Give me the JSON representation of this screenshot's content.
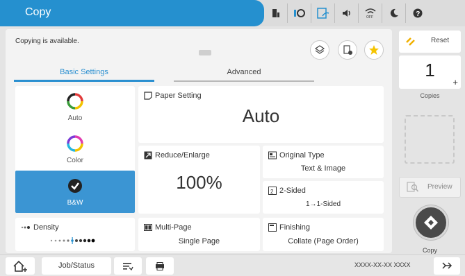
{
  "header": {
    "title": "Copy",
    "icons": [
      "ink-levels-icon",
      "device-info-icon",
      "wifi-direct-icon",
      "sound-icon",
      "wifi-off-icon",
      "sleep-icon",
      "help-icon"
    ]
  },
  "status": {
    "message": "Copying is available."
  },
  "tabs": [
    {
      "label": "Basic Settings",
      "active": true
    },
    {
      "label": "Advanced",
      "active": false
    }
  ],
  "color_modes": [
    {
      "label": "Auto",
      "selected": false
    },
    {
      "label": "Color",
      "selected": false
    },
    {
      "label": "B&W",
      "selected": true
    }
  ],
  "density": {
    "label": "Density"
  },
  "paper_setting": {
    "label": "Paper Setting",
    "value": "Auto"
  },
  "reduce_enlarge": {
    "label": "Reduce/Enlarge",
    "value": "100%"
  },
  "original_type": {
    "label": "Original Type",
    "value": "Text & Image"
  },
  "two_sided": {
    "label": "2-Sided",
    "value": "1→1-Sided"
  },
  "multi_page": {
    "label": "Multi-Page",
    "value": "Single Page"
  },
  "finishing": {
    "label": "Finishing",
    "value": "Collate (Page Order)"
  },
  "right_panel": {
    "reset_label": "Reset",
    "copies_value": "1",
    "copies_plus": "+",
    "copies_label": "Copies",
    "preview_label": "Preview",
    "copy_label": "Copy"
  },
  "bottom_bar": {
    "job_status_label": "Job/Status",
    "datetime": "XXXX-XX-XX XXXX"
  },
  "colors": {
    "accent": "#2590cf",
    "selected_tile": "#3b95d3",
    "reset_icon": "#f0b000",
    "favorite_star": "#f5c400"
  }
}
